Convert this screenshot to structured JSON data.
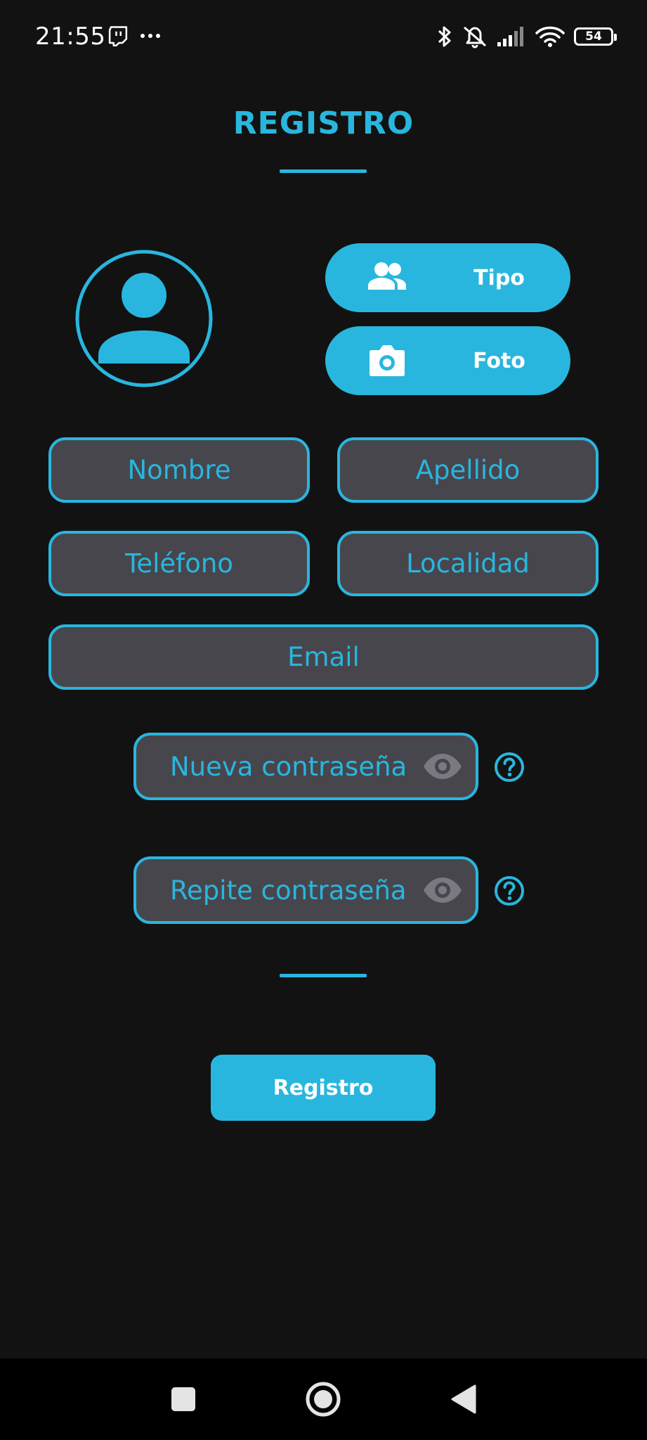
{
  "status_bar": {
    "time": "21:55",
    "battery_level": "54",
    "icons_left": [
      "twitch-icon",
      "more-dots-icon"
    ],
    "icons_right": [
      "bluetooth-icon",
      "mute-bell-icon",
      "signal-icon",
      "wifi-icon",
      "battery-icon"
    ]
  },
  "header": {
    "title": "REGISTRO"
  },
  "profile": {
    "avatar_icon": "user-avatar-icon",
    "type_button": {
      "label": "Tipo",
      "icon": "group-icon"
    },
    "photo_button": {
      "label": "Foto",
      "icon": "camera-icon"
    }
  },
  "form": {
    "first_name": {
      "placeholder": "Nombre",
      "value": ""
    },
    "last_name": {
      "placeholder": "Apellido",
      "value": ""
    },
    "phone": {
      "placeholder": "Teléfono",
      "value": ""
    },
    "locality": {
      "placeholder": "Localidad",
      "value": ""
    },
    "email": {
      "placeholder": "Email",
      "value": ""
    },
    "new_password": {
      "placeholder": "Nueva contraseña",
      "value": ""
    },
    "repeat_password": {
      "placeholder": "Repite contraseña",
      "value": ""
    },
    "submit_label": "Registro"
  },
  "colors": {
    "accent": "#29b6de",
    "background": "#121212",
    "field_background": "#48464d",
    "eye_icon": "#7a7880",
    "nav_background": "#000000"
  },
  "nav_bar": {
    "icons": [
      "recents-square-icon",
      "home-circle-icon",
      "back-triangle-icon"
    ]
  }
}
